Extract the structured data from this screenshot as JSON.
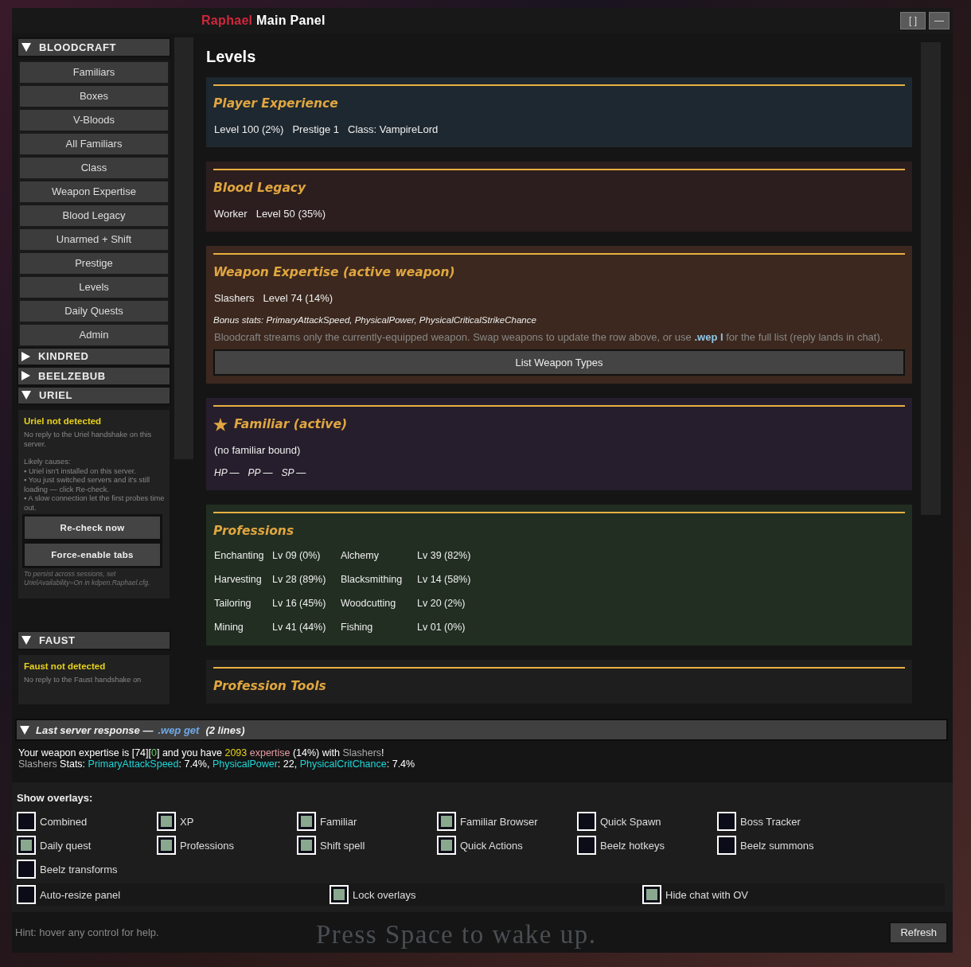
{
  "window": {
    "title_accent": "Raphael",
    "title": "Main Panel",
    "buttons": [
      "[ ]",
      "—"
    ]
  },
  "sidebar": {
    "sections": [
      {
        "label": "BLOODCRAFT",
        "expanded": true,
        "items": [
          "Familiars",
          "Boxes",
          "V-Bloods",
          "All Familiars",
          "Class",
          "Weapon Expertise",
          "Blood Legacy",
          "Unarmed + Shift",
          "Prestige",
          "Levels",
          "Daily Quests",
          "Admin"
        ]
      },
      {
        "label": "KINDRED",
        "expanded": false
      },
      {
        "label": "BEELZEBUB",
        "expanded": false
      },
      {
        "label": "URIEL",
        "expanded": true,
        "notice": {
          "title": "Uriel not detected",
          "paragraphs": [
            "No reply to the Uriel handshake on this server.",
            "Likely causes:\n▪ Uriel isn't installed on this server.\n▪ You just switched servers and it's still loading — click Re-check.\n▪ A slow connection let the first probes time out."
          ],
          "buttons": [
            "Re-check now",
            "Force-enable tabs"
          ],
          "footnote": "To persist across sessions, set UrielAvailability=On in kdpen.Raphael.cfg."
        }
      },
      {
        "label": "FAUST",
        "expanded": true,
        "notice": {
          "title": "Faust not detected",
          "paragraphs": [
            "No reply to the Faust handshake on"
          ]
        }
      }
    ]
  },
  "content": {
    "heading": "Levels",
    "cards": [
      {
        "kind": "stats",
        "color": "#1e2830",
        "title": "Player Experience",
        "stats": [
          "Level 100 (2%)",
          "Prestige 1",
          "Class: VampireLord"
        ]
      },
      {
        "kind": "stats",
        "color": "#2c1e1e",
        "title": "Blood Legacy",
        "stats": [
          "Worker",
          "Level 50 (35%)"
        ]
      },
      {
        "kind": "weapon",
        "color": "#3c281e",
        "title": "Weapon Expertise (active weapon)",
        "stats": [
          "Slashers",
          "Level 74 (14%)"
        ],
        "bonus": "Bonus stats: PrimaryAttackSpeed, PhysicalPower, PhysicalCriticalStrikeChance",
        "note": "Bloodcraft streams only the currently-equipped weapon. Swap weapons to update the row above, or use **.wep l** for the full list (reply lands in chat).",
        "button": "List Weapon Types"
      },
      {
        "kind": "familiar",
        "color": "#261e2c",
        "title": "Familiar (active)",
        "line": "(no familiar bound)",
        "stats": [
          "HP —",
          "PP —",
          "SP —"
        ]
      },
      {
        "kind": "professions",
        "color": "#222e22",
        "title": "Professions",
        "rows": [
          [
            "Enchanting",
            "Lv 09 (0%)",
            "Alchemy",
            "Lv 39 (82%)"
          ],
          [
            "Harvesting",
            "Lv 28 (89%)",
            "Blacksmithing",
            "Lv 14 (58%)"
          ],
          [
            "Tailoring",
            "Lv 16 (45%)",
            "Woodcutting",
            "Lv 20 (2%)"
          ],
          [
            "Mining",
            "Lv 41 (44%)",
            "Fishing",
            "Lv 01 (0%)"
          ]
        ]
      },
      {
        "kind": "title_only",
        "color": "#1e1e1e",
        "title": "Profession Tools"
      }
    ]
  },
  "response": {
    "expanded": true,
    "title": "Last server response —",
    "command": ".wep get",
    "count": "(2 lines)",
    "lines": [
      [
        {
          "kind": "plain",
          "text": "Your weapon expertise is [74]["
        },
        {
          "kind": "good",
          "text": "0"
        },
        {
          "kind": "plain",
          "text": "] and you have "
        },
        {
          "kind": "number",
          "text": "2093"
        },
        {
          "kind": "highlight",
          "text": " expertise"
        },
        {
          "kind": "plain",
          "text": " (14%) with "
        },
        {
          "kind": "dim",
          "text": "Slashers"
        },
        {
          "kind": "plain",
          "text": "!"
        }
      ],
      [
        {
          "kind": "dim",
          "text": "Slashers"
        },
        {
          "kind": "plain",
          "text": " Stats: "
        },
        {
          "kind": "stat",
          "text": "PrimaryAttackSpeed"
        },
        {
          "kind": "plain",
          "text": ": 7.4%, "
        },
        {
          "kind": "stat",
          "text": "PhysicalPower"
        },
        {
          "kind": "plain",
          "text": ": 22, "
        },
        {
          "kind": "stat",
          "text": "PhysicalCritChance"
        },
        {
          "kind": "plain",
          "text": ": 7.4%"
        }
      ]
    ]
  },
  "overlays": {
    "label": "Show overlays:",
    "items": [
      {
        "label": "Combined",
        "checked": false
      },
      {
        "label": "XP",
        "checked": true
      },
      {
        "label": "Familiar",
        "checked": true
      },
      {
        "label": "Familiar Browser",
        "checked": true
      },
      {
        "label": "Quick Spawn",
        "checked": false
      },
      {
        "label": "Boss Tracker",
        "checked": false
      },
      {
        "label": "Daily quest",
        "checked": true
      },
      {
        "label": "Professions",
        "checked": true
      },
      {
        "label": "Shift spell",
        "checked": true
      },
      {
        "label": "Quick Actions",
        "checked": true
      },
      {
        "label": "Beelz hotkeys",
        "checked": false
      },
      {
        "label": "Beelz summons",
        "checked": false
      },
      {
        "label": "Beelz transforms",
        "checked": false
      }
    ],
    "options": [
      {
        "label": "Auto-resize panel",
        "checked": false
      },
      {
        "label": "Lock overlays",
        "checked": true
      },
      {
        "label": "Hide chat with OV",
        "checked": true
      }
    ]
  },
  "footer": {
    "hint": "Hint: hover any control for help.",
    "background_text": "Press Space to wake up.",
    "button": "Refresh"
  }
}
